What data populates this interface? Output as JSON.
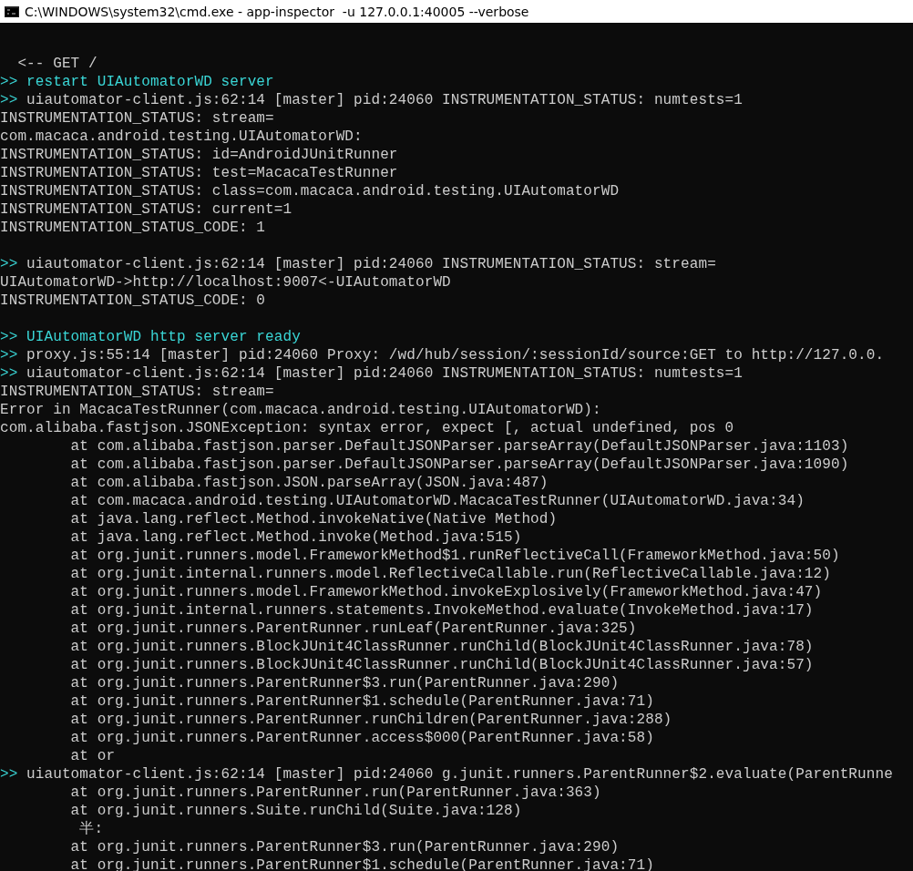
{
  "window": {
    "title": "C:\\WINDOWS\\system32\\cmd.exe - app-inspector  -u 127.0.0.1:40005 --verbose"
  },
  "console": {
    "lines": [
      {
        "kind": "blank"
      },
      {
        "kind": "request",
        "text": "  <-- GET /"
      },
      {
        "kind": "notice",
        "prompt": ">>",
        "text": "restart UIAutomatorWD server"
      },
      {
        "kind": "event",
        "prompt": ">>",
        "text": "uiautomator-client.js:62:14 [master] pid:24060 INSTRUMENTATION_STATUS: numtests=1"
      },
      {
        "kind": "output",
        "text": "INSTRUMENTATION_STATUS: stream="
      },
      {
        "kind": "output",
        "text": "com.macaca.android.testing.UIAutomatorWD:"
      },
      {
        "kind": "output",
        "text": "INSTRUMENTATION_STATUS: id=AndroidJUnitRunner"
      },
      {
        "kind": "output",
        "text": "INSTRUMENTATION_STATUS: test=MacacaTestRunner"
      },
      {
        "kind": "output",
        "text": "INSTRUMENTATION_STATUS: class=com.macaca.android.testing.UIAutomatorWD"
      },
      {
        "kind": "output",
        "text": "INSTRUMENTATION_STATUS: current=1"
      },
      {
        "kind": "output",
        "text": "INSTRUMENTATION_STATUS_CODE: 1"
      },
      {
        "kind": "blank"
      },
      {
        "kind": "event",
        "prompt": ">>",
        "text": "uiautomator-client.js:62:14 [master] pid:24060 INSTRUMENTATION_STATUS: stream="
      },
      {
        "kind": "output",
        "text": "UIAutomatorWD->http://localhost:9007<-UIAutomatorWD"
      },
      {
        "kind": "output",
        "text": "INSTRUMENTATION_STATUS_CODE: 0"
      },
      {
        "kind": "blank"
      },
      {
        "kind": "notice",
        "prompt": ">>",
        "text": "UIAutomatorWD http server ready"
      },
      {
        "kind": "event",
        "prompt": ">>",
        "text": "proxy.js:55:14 [master] pid:24060 Proxy: /wd/hub/session/:sessionId/source:GET to http://127.0.0."
      },
      {
        "kind": "event",
        "prompt": ">>",
        "text": "uiautomator-client.js:62:14 [master] pid:24060 INSTRUMENTATION_STATUS: numtests=1"
      },
      {
        "kind": "output",
        "text": "INSTRUMENTATION_STATUS: stream="
      },
      {
        "kind": "output",
        "text": "Error in MacacaTestRunner(com.macaca.android.testing.UIAutomatorWD):"
      },
      {
        "kind": "output",
        "text": "com.alibaba.fastjson.JSONException: syntax error, expect [, actual undefined, pos 0"
      },
      {
        "kind": "output",
        "text": "        at com.alibaba.fastjson.parser.DefaultJSONParser.parseArray(DefaultJSONParser.java:1103)"
      },
      {
        "kind": "output",
        "text": "        at com.alibaba.fastjson.parser.DefaultJSONParser.parseArray(DefaultJSONParser.java:1090)"
      },
      {
        "kind": "output",
        "text": "        at com.alibaba.fastjson.JSON.parseArray(JSON.java:487)"
      },
      {
        "kind": "output",
        "text": "        at com.macaca.android.testing.UIAutomatorWD.MacacaTestRunner(UIAutomatorWD.java:34)"
      },
      {
        "kind": "output",
        "text": "        at java.lang.reflect.Method.invokeNative(Native Method)"
      },
      {
        "kind": "output",
        "text": "        at java.lang.reflect.Method.invoke(Method.java:515)"
      },
      {
        "kind": "output",
        "text": "        at org.junit.runners.model.FrameworkMethod$1.runReflectiveCall(FrameworkMethod.java:50)"
      },
      {
        "kind": "output",
        "text": "        at org.junit.internal.runners.model.ReflectiveCallable.run(ReflectiveCallable.java:12)"
      },
      {
        "kind": "output",
        "text": "        at org.junit.runners.model.FrameworkMethod.invokeExplosively(FrameworkMethod.java:47)"
      },
      {
        "kind": "output",
        "text": "        at org.junit.internal.runners.statements.InvokeMethod.evaluate(InvokeMethod.java:17)"
      },
      {
        "kind": "output",
        "text": "        at org.junit.runners.ParentRunner.runLeaf(ParentRunner.java:325)"
      },
      {
        "kind": "output",
        "text": "        at org.junit.runners.BlockJUnit4ClassRunner.runChild(BlockJUnit4ClassRunner.java:78)"
      },
      {
        "kind": "output",
        "text": "        at org.junit.runners.BlockJUnit4ClassRunner.runChild(BlockJUnit4ClassRunner.java:57)"
      },
      {
        "kind": "output",
        "text": "        at org.junit.runners.ParentRunner$3.run(ParentRunner.java:290)"
      },
      {
        "kind": "output",
        "text": "        at org.junit.runners.ParentRunner$1.schedule(ParentRunner.java:71)"
      },
      {
        "kind": "output",
        "text": "        at org.junit.runners.ParentRunner.runChildren(ParentRunner.java:288)"
      },
      {
        "kind": "output",
        "text": "        at org.junit.runners.ParentRunner.access$000(ParentRunner.java:58)"
      },
      {
        "kind": "output",
        "text": "        at or"
      },
      {
        "kind": "event",
        "prompt": ">>",
        "text": "uiautomator-client.js:62:14 [master] pid:24060 g.junit.runners.ParentRunner$2.evaluate(ParentRunne"
      },
      {
        "kind": "output",
        "text": "        at org.junit.runners.ParentRunner.run(ParentRunner.java:363)"
      },
      {
        "kind": "output",
        "text": "        at org.junit.runners.Suite.runChild(Suite.java:128)"
      },
      {
        "kind": "output",
        "text": "         半:"
      },
      {
        "kind": "output",
        "text": "        at org.junit.runners.ParentRunner$3.run(ParentRunner.java:290)"
      },
      {
        "kind": "output",
        "text": "        at org.junit.runners.ParentRunner$1.schedule(ParentRunner.java:71)"
      }
    ]
  }
}
